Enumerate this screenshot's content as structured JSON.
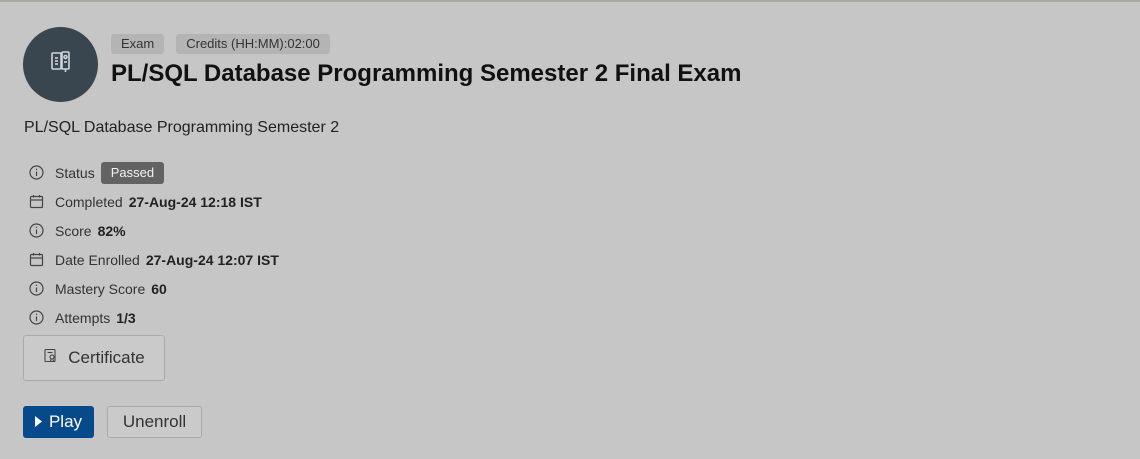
{
  "header": {
    "tags": [
      "Exam",
      "Credits (HH:MM):02:00"
    ],
    "title": "PL/SQL Database Programming Semester 2 Final Exam",
    "subtitle": "PL/SQL Database Programming Semester 2",
    "avatar_icon": "exam-notebook-icon"
  },
  "details": {
    "status_label": "Status",
    "status_value": "Passed",
    "completed_label": "Completed",
    "completed_value": "27-Aug-24 12:18 IST",
    "score_label": "Score",
    "score_value": "82%",
    "enrolled_label": "Date Enrolled",
    "enrolled_value": "27-Aug-24 12:07 IST",
    "mastery_label": "Mastery Score",
    "mastery_value": "60",
    "attempts_label": "Attempts",
    "attempts_value": "1/3"
  },
  "actions": {
    "certificate_label": "Certificate",
    "play_label": "Play",
    "unenroll_label": "Unenroll"
  },
  "colors": {
    "background": "#c6c6c6",
    "avatar": "#3a464f",
    "play_button": "#064a8c",
    "status_badge": "#636363"
  }
}
